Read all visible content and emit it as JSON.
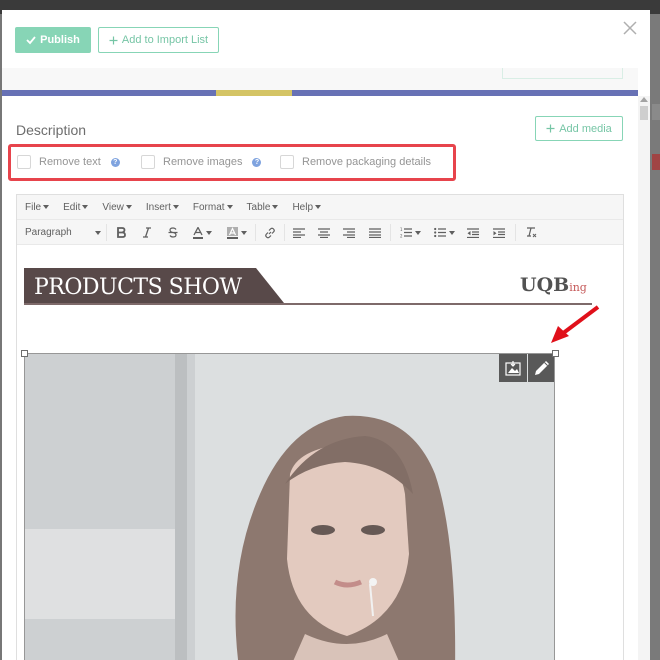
{
  "header": {
    "publish_label": "Publish",
    "import_label": "Add to Import List"
  },
  "description": {
    "title": "Description",
    "add_media_label": "Add media",
    "options": [
      {
        "label": "Remove text",
        "help": "?"
      },
      {
        "label": "Remove images",
        "help": "?"
      },
      {
        "label": "Remove packaging details"
      }
    ]
  },
  "editor": {
    "menu": [
      "File",
      "Edit",
      "View",
      "Insert",
      "Format",
      "Table",
      "Help"
    ],
    "format_select": "Paragraph",
    "banner_title": "PRODUCTS SHOW",
    "banner_logo_main": "UQB",
    "banner_logo_sub": "ing"
  },
  "colors": {
    "accent": "#66c9a2",
    "highlight": "#e0101a"
  }
}
